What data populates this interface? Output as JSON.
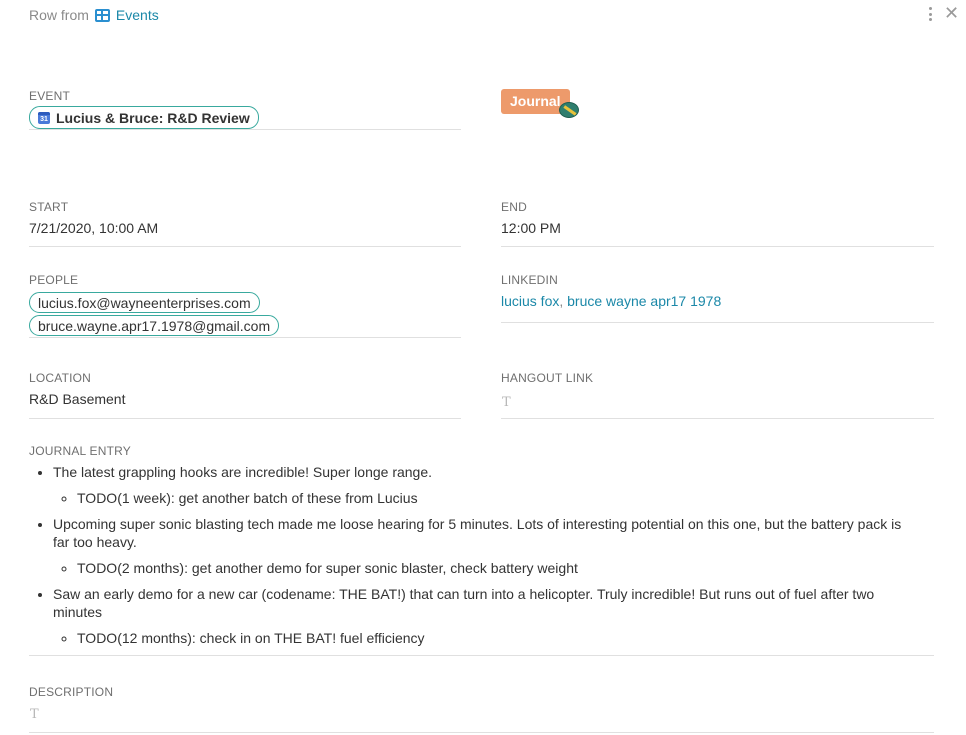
{
  "topbar": {
    "row_from": "Row from",
    "table_name": "Events"
  },
  "event": {
    "label": "EVENT",
    "chip_text": "Lucius & Bruce: R&D Review",
    "cal_day": "31"
  },
  "journal": {
    "badge": "Journal"
  },
  "start": {
    "label": "START",
    "value": "7/21/2020, 10:00 AM"
  },
  "end": {
    "label": "END",
    "value": "12:00 PM"
  },
  "people": {
    "label": "PEOPLE",
    "items": [
      "lucius.fox@wayneenterprises.com",
      "bruce.wayne.apr17.1978@gmail.com"
    ]
  },
  "linkedin": {
    "label": "LINKEDIN",
    "items": [
      "lucius fox",
      "bruce wayne apr17 1978"
    ],
    "separator": ","
  },
  "location": {
    "label": "LOCATION",
    "value": "R&D Basement"
  },
  "hangout": {
    "label": "HANGOUT LINK",
    "placeholder_glyph": "T"
  },
  "journal_entry": {
    "label": "JOURNAL ENTRY",
    "bullets": [
      {
        "text": "The latest grappling hooks are incredible! Super longe range.",
        "sub": "TODO(1 week): get another batch of these from Lucius"
      },
      {
        "text": "Upcoming super sonic blasting tech made me loose hearing for 5 minutes. Lots of interesting potential on this one, but the battery pack is far too heavy.",
        "sub": "TODO(2 months): get another demo for super sonic blaster, check battery weight"
      },
      {
        "text": "Saw an early demo for a new car (codename: THE BAT!) that can turn into a helicopter. Truly incredible! But runs out of fuel after two minutes",
        "sub": "TODO(12 months): check in on THE BAT! fuel efficiency"
      }
    ]
  },
  "description": {
    "label": "DESCRIPTION",
    "placeholder_glyph": "T"
  },
  "icons": {
    "table": "table-icon",
    "calendar": "calendar-icon",
    "menu": "more-vertical-icon",
    "close": "close-icon"
  },
  "colors": {
    "accent": "#1b88a8",
    "chip_border": "#39a99e",
    "journal_badge": "#ed9a6b",
    "calendar_blue": "#4a7ad9"
  }
}
